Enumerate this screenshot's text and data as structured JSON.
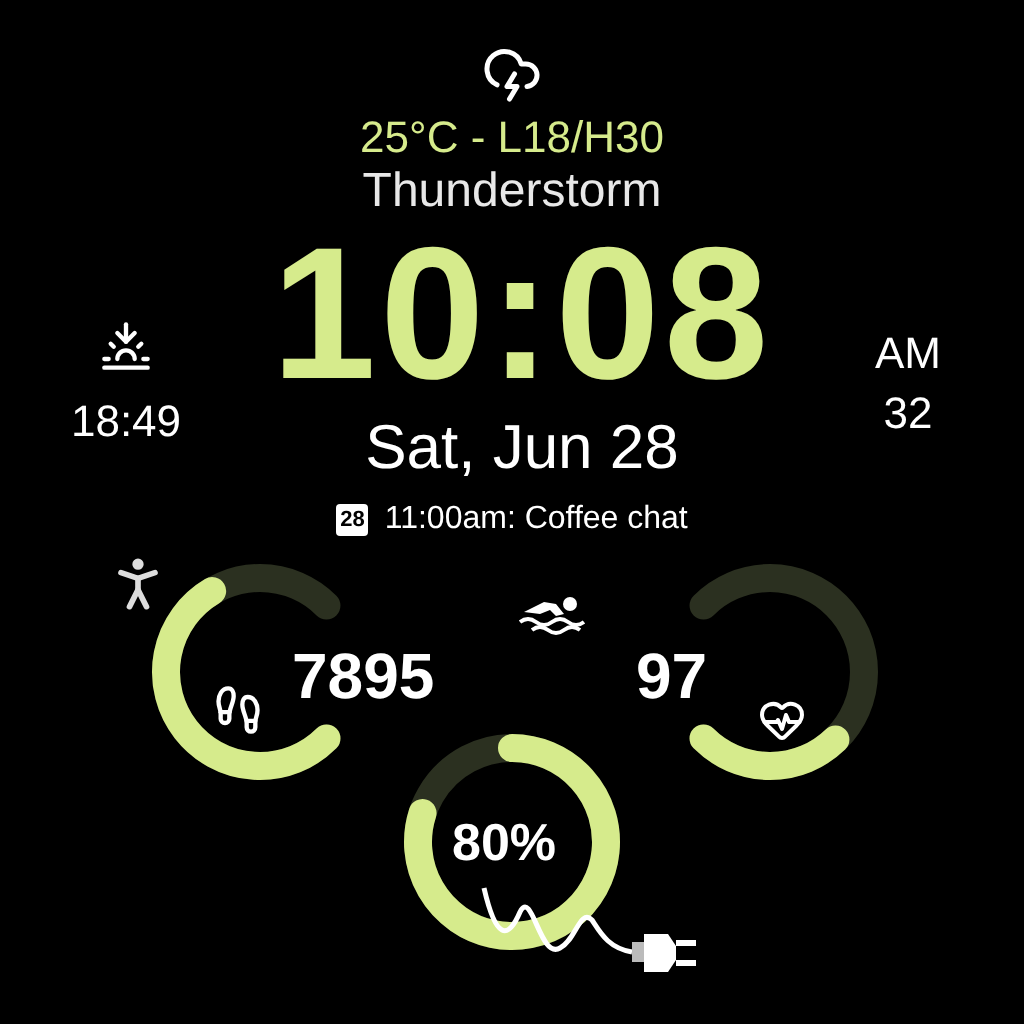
{
  "weather": {
    "temperature": "25°C - L18/H30",
    "condition": "Thunderstorm"
  },
  "sunset": {
    "time": "18:49"
  },
  "clock": {
    "time": "10:08",
    "period": "AM",
    "seconds": "32",
    "date": "Sat, Jun 28"
  },
  "event": {
    "day": "28",
    "text": "11:00am: Coffee chat"
  },
  "gauges": [
    {
      "kind": "steps",
      "value": "7895"
    },
    {
      "kind": "heart",
      "value": "97"
    },
    {
      "kind": "battery",
      "value": "80%"
    }
  ]
}
